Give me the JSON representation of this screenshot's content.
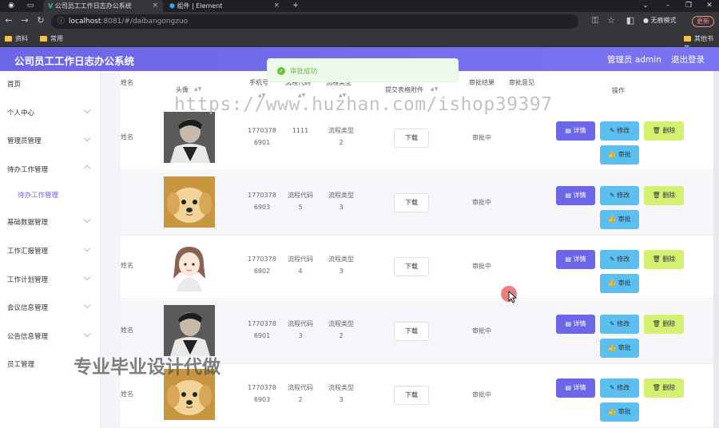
{
  "browser": {
    "tabs": [
      {
        "label": "公司员工工作日志办公系统"
      },
      {
        "label": "组件 | Element"
      }
    ],
    "url_host": "localhost",
    "url_rest": ":8081/#/daibangongzuo",
    "incognito": "无痕模式",
    "update": "更新",
    "bookmarks": [
      {
        "label": "资料"
      },
      {
        "label": "常用"
      },
      {
        "label": "其他书签"
      }
    ]
  },
  "app": {
    "title": "公司员工工作日志办公系统",
    "user": "管理员 admin",
    "logout": "退出登录"
  },
  "toast": {
    "text": "审批成功"
  },
  "sidebar": {
    "items": [
      {
        "label": "首页"
      },
      {
        "label": "个人中心"
      },
      {
        "label": "管理员管理"
      },
      {
        "label": "待办工作管理"
      },
      {
        "label": "待办工作管理"
      },
      {
        "label": "基础数据管理"
      },
      {
        "label": "工作汇报管理"
      },
      {
        "label": "工作计划管理"
      },
      {
        "label": "会议信息管理"
      },
      {
        "label": "公告信息管理"
      },
      {
        "label": "员工管理"
      }
    ]
  },
  "table": {
    "headers": {
      "name": "姓名",
      "avatar": "头像",
      "phone": "手机号",
      "code": "流程代码",
      "type": "流程类型",
      "attachment": "提交表格附件",
      "result": "审批结果",
      "opinion": "审批意见",
      "ops": "操作"
    },
    "buttons": {
      "download": "下载",
      "detail": "详情",
      "edit": "修改",
      "delete": "删除",
      "approve": "审批"
    },
    "rows": [
      {
        "name": "姓名",
        "phone1": "1770378",
        "phone2": "6901",
        "code1": "1111",
        "code2": "",
        "type1": "流程类型",
        "type2": "2",
        "status": "审批中",
        "avatar": "man-dark"
      },
      {
        "name": "",
        "phone1": "1770378",
        "phone2": "6903",
        "code1": "流程代码",
        "code2": "5",
        "type1": "流程类型",
        "type2": "3",
        "status": "审批中",
        "avatar": "puppy"
      },
      {
        "name": "姓名",
        "phone1": "1770378",
        "phone2": "6902",
        "code1": "流程代码",
        "code2": "4",
        "type1": "流程类型",
        "type2": "3",
        "status": "审批中",
        "avatar": "girl-cartoon"
      },
      {
        "name": "姓名",
        "phone1": "1770378",
        "phone2": "6901",
        "code1": "流程代码",
        "code2": "3",
        "type1": "流程类型",
        "type2": "2",
        "status": "审批中",
        "avatar": "man-dark"
      },
      {
        "name": "姓名",
        "phone1": "1770378",
        "phone2": "6903",
        "code1": "流程代码",
        "code2": "2",
        "type1": "流程类型",
        "type2": "3",
        "status": "审批中",
        "avatar": "puppy"
      }
    ]
  },
  "watermarks": {
    "url": "https://www.huzhan.com/ishop39397",
    "slogan": "专业毕业设计代做"
  }
}
